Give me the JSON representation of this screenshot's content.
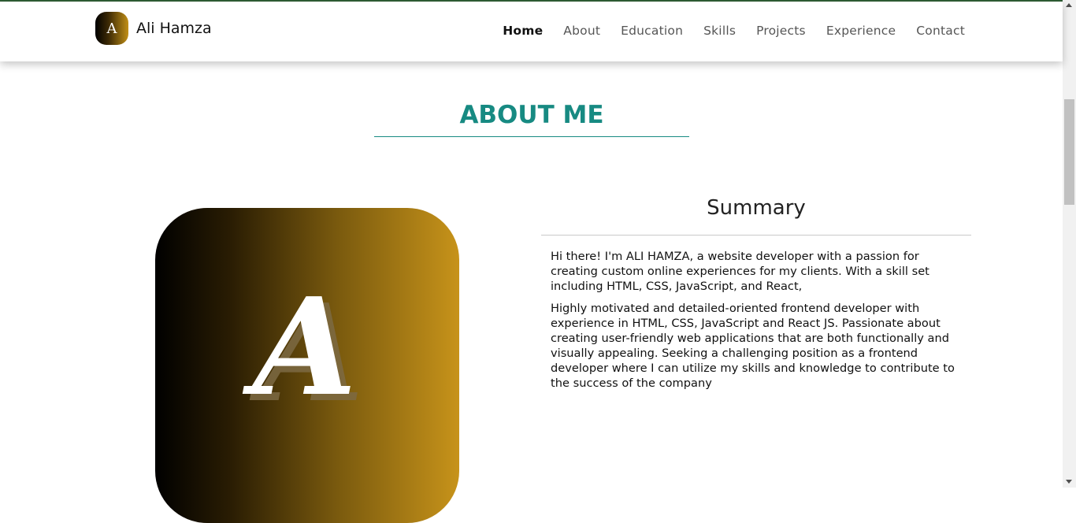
{
  "brand": {
    "logo_letter": "A",
    "name": "Ali Hamza"
  },
  "nav": {
    "items": [
      {
        "label": "Home",
        "active": true
      },
      {
        "label": "About"
      },
      {
        "label": "Education"
      },
      {
        "label": "Skills"
      },
      {
        "label": "Projects"
      },
      {
        "label": "Experience"
      },
      {
        "label": "Contact"
      }
    ]
  },
  "about": {
    "title": "ABOUT ME",
    "avatar_letter": "A",
    "summary_title": "Summary",
    "paragraphs": [
      "Hi there! I'm ALI HAMZA, a website developer with a passion for creating custom online experiences for my clients. With a skill set including HTML, CSS, JavaScript, and React,",
      "Highly motivated and detailed-oriented frontend developer with experience in HTML, CSS, JavaScript and React JS. Passionate about creating user-friendly web applications that are both functionally and visually appealing. Seeking a challenging position as a frontend developer where I can utilize my skills and knowledge to contribute to the success of the company"
    ]
  },
  "colors": {
    "accent": "#178a82",
    "gold": "#c7931a",
    "topline": "#2e5d34"
  }
}
